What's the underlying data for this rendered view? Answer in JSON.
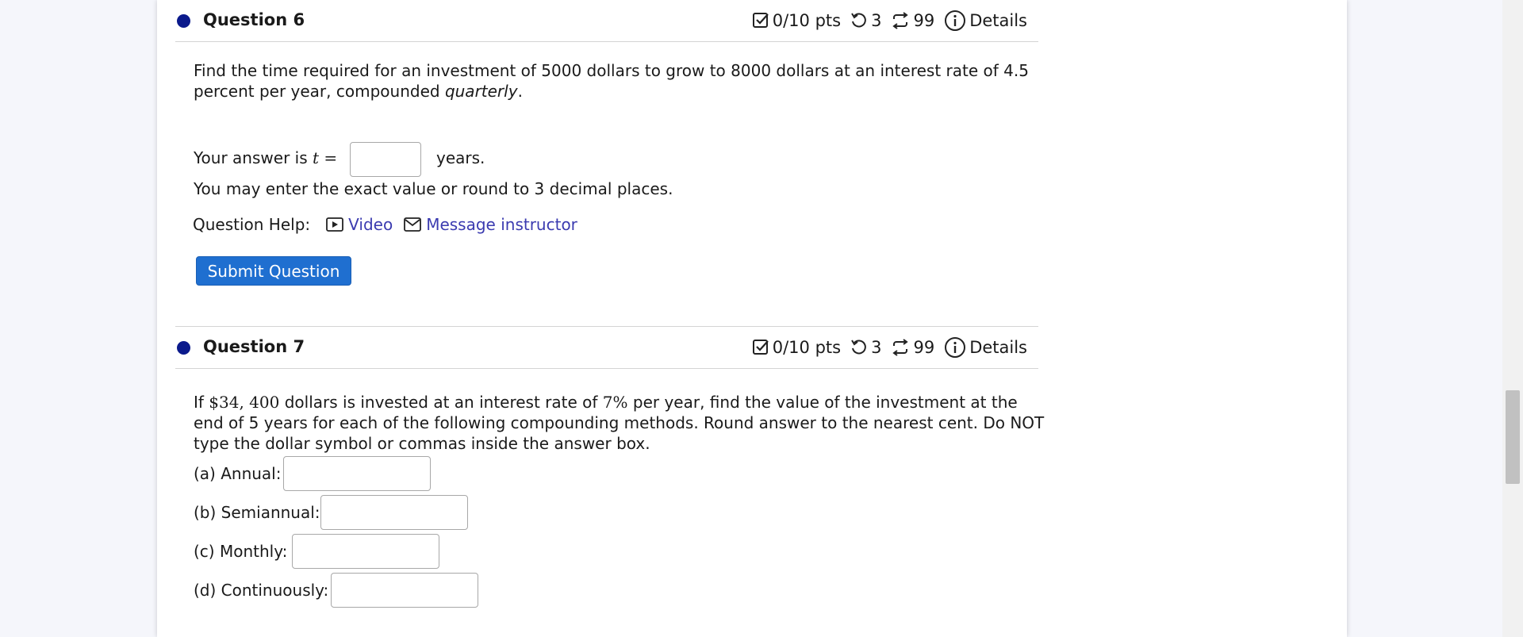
{
  "question6": {
    "title": "Question 6",
    "points": "0/10 pts",
    "retries": "3",
    "attempts": "99",
    "details_label": "Details",
    "prompt_line1": "Find the time required for an investment of 5000 dollars to grow to 8000 dollars at an interest rate of 4.5",
    "prompt_line2_a": "percent per year, compounded ",
    "prompt_line2_em": "quarterly",
    "prompt_line2_b": ".",
    "answer_prefix": "Your answer is ",
    "answer_var": "t",
    "answer_eq": " =",
    "answer_suffix": "years.",
    "answer_value": "",
    "hint": "You may enter the exact value or round to 3 decimal places.",
    "help_label": "Question Help:",
    "video_label": "Video",
    "message_label": "Message instructor",
    "submit_label": "Submit Question"
  },
  "question7": {
    "title": "Question 7",
    "points": "0/10 pts",
    "retries": "3",
    "attempts": "99",
    "details_label": "Details",
    "prompt_line1_a": "If ",
    "prompt_amount": "$34, 400",
    "prompt_line1_b": " dollars is invested at an interest rate of ",
    "prompt_rate": "7%",
    "prompt_line1_c": " per year, find the value of the investment at the",
    "prompt_line2": "end of 5 years for each of the following compounding methods. Round answer to the nearest cent. Do NOT",
    "prompt_line3": "type the dollar symbol or commas inside the answer box.",
    "parts": [
      {
        "label": "(a) Annual:",
        "value": ""
      },
      {
        "label": "(b) Semiannual:",
        "value": ""
      },
      {
        "label": "(c) Monthly:",
        "value": ""
      },
      {
        "label": "(d) Continuously:",
        "value": ""
      }
    ]
  },
  "colors": {
    "dot": "#0b1a8c",
    "link": "#3b3bb0",
    "button": "#1f6fd0"
  }
}
